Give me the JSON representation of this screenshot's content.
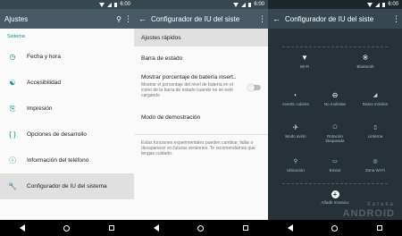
{
  "status": {
    "time": "6:00"
  },
  "panel1": {
    "title": "Ajustes",
    "section": "Sistema",
    "items": [
      {
        "label": "Fecha y hora"
      },
      {
        "label": "Accesibilidad"
      },
      {
        "label": "Impresión"
      },
      {
        "label": "Opciones de desarrollo"
      },
      {
        "label": "Información del teléfono"
      },
      {
        "label": "Configurador de IU del sistema"
      }
    ]
  },
  "panel2": {
    "title": "Configurador de IU del siste",
    "quick_settings": "Ajustes rápidos",
    "status_bar": "Barra de estado",
    "battery_title": "Mostrar porcentaje de batería insert..",
    "battery_desc": "Mostrar el porcentaje del nivel de batería en el icono de la barra de estado cuando no se esté cargando",
    "demo_mode": "Modo de demostración",
    "note": "Estas funciones experimentales pueden cambiar, fallar o desaparecer en futuras versiones. Te recomendamos que tengas cuidado."
  },
  "panel3": {
    "title": "Configurador de IU del siste",
    "big_tiles": [
      {
        "label": "Wi-Fi",
        "icon": "wifi-icon"
      },
      {
        "label": "Bluetooth",
        "icon": "bluetooth-icon"
      }
    ],
    "tiles": [
      {
        "label": "Invertir colores",
        "icon": "invert-colors-icon"
      },
      {
        "label": "No molestar",
        "icon": "do-not-disturb-icon"
      },
      {
        "label": "Datos móviles",
        "icon": "mobile-data-icon"
      },
      {
        "label": "Modo avión",
        "icon": "airplane-icon"
      },
      {
        "label": "Rotación bloqueada",
        "icon": "rotation-lock-icon"
      },
      {
        "label": "Linterna",
        "icon": "flashlight-icon"
      },
      {
        "label": "Ubicación",
        "icon": "location-icon"
      },
      {
        "label": "Enviar",
        "icon": "cast-icon"
      },
      {
        "label": "Zona Wi-Fi",
        "icon": "hotspot-icon"
      }
    ],
    "add_tile": "Añadir mosaico"
  },
  "watermark": {
    "line1": "Xataka",
    "line2": "ANDROID"
  },
  "colors": {
    "accent": "#009688",
    "toolbar": "#455a64",
    "dark_bg": "#263238"
  }
}
